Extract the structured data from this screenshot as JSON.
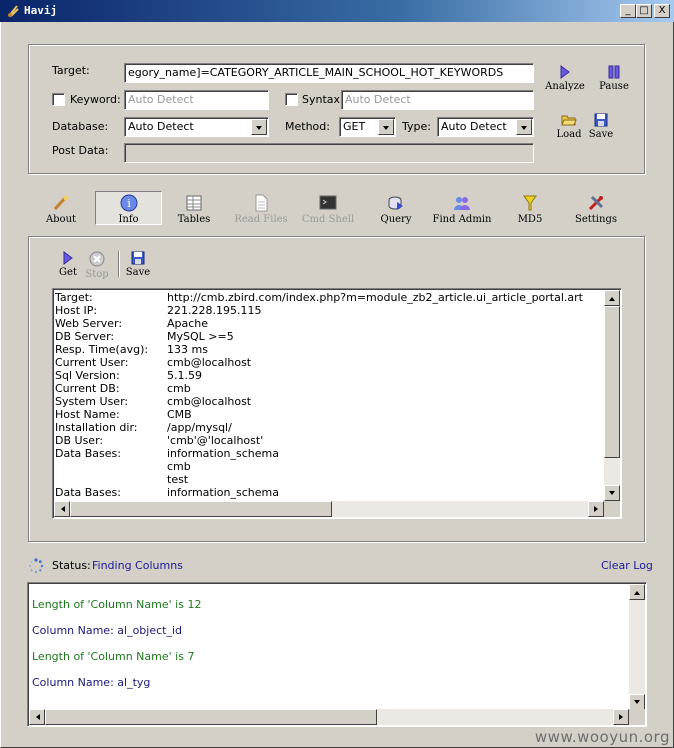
{
  "window": {
    "title": "Havij",
    "minimize_label": "_",
    "maximize_label": "□",
    "close_label": "X"
  },
  "target_panel": {
    "target_label": "Target:",
    "target_value": "egory_name]=CATEGORY_ARTICLE_MAIN_SCHOOL_HOT_KEYWORDS",
    "keyword_label": "Keyword:",
    "keyword_placeholder": "Auto Detect",
    "syntax_label": "Syntax:",
    "syntax_placeholder": "Auto Detect",
    "database_label": "Database:",
    "database_value": "Auto Detect",
    "method_label": "Method:",
    "method_value": "GET",
    "type_label": "Type:",
    "type_value": "Auto Detect",
    "post_data_label": "Post Data:",
    "post_data_value": "",
    "analyze_label": "Analyze",
    "pause_label": "Pause",
    "load_label": "Load",
    "save_label": "Save"
  },
  "toolbar": {
    "about": "About",
    "info": "Info",
    "tables": "Tables",
    "read_files": "Read Files",
    "cmd_shell": "Cmd Shell",
    "query": "Query",
    "find_admin": "Find Admin",
    "md5": "MD5",
    "settings": "Settings"
  },
  "info_panel": {
    "get_label": "Get",
    "stop_label": "Stop",
    "save_label": "Save",
    "rows": [
      {
        "k": "Target:",
        "v": "http://cmb.zbird.com/index.php?m=module_zb2_article.ui_article_portal.art"
      },
      {
        "k": "Host IP:",
        "v": "221.228.195.115"
      },
      {
        "k": "Web Server:",
        "v": "Apache"
      },
      {
        "k": "DB Server:",
        "v": "MySQL >=5"
      },
      {
        "k": "Resp. Time(avg):",
        "v": "133 ms"
      },
      {
        "k": "Current User:",
        "v": "cmb@localhost"
      },
      {
        "k": "Sql Version:",
        "v": "5.1.59"
      },
      {
        "k": "Current DB:",
        "v": "cmb"
      },
      {
        "k": "System User:",
        "v": "cmb@localhost"
      },
      {
        "k": "Host Name:",
        "v": "CMB"
      },
      {
        "k": "Installation dir:",
        "v": "/app/mysql/"
      },
      {
        "k": "DB User:",
        "v": "'cmb'@'localhost'"
      },
      {
        "k": "Data Bases:",
        "v": "information_schema"
      },
      {
        "k": "",
        "v": "cmb"
      },
      {
        "k": "",
        "v": "test"
      },
      {
        "k": "Data Bases:",
        "v": "information_schema"
      }
    ]
  },
  "status": {
    "label": "Status:",
    "value": "Finding Columns",
    "clear_log": "Clear Log"
  },
  "log": [
    {
      "text": "Length of 'Column Name' is 12",
      "color": "#1e7a1e"
    },
    {
      "text": "Column Name: al_object_id",
      "color": "#1a1a7a"
    },
    {
      "text": "Length of 'Column Name' is 7",
      "color": "#1e7a1e"
    },
    {
      "text": "Column Name: al_tyg",
      "color": "#1a1a7a"
    }
  ],
  "watermark": "www.wooyun.org"
}
